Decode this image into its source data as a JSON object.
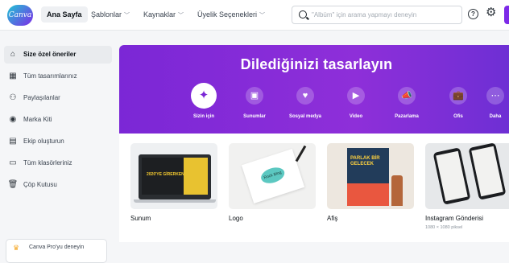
{
  "app": {
    "logo_text": "Canva"
  },
  "nav": {
    "home": "Ana Sayfa",
    "templates": "Şablonlar",
    "resources": "Kaynaklar",
    "membership": "Üyelik Seçenekleri"
  },
  "search": {
    "placeholder": "\"Albüm\" için arama yapmayı deneyin"
  },
  "header_icons": {
    "help": "?",
    "settings": "⚙"
  },
  "sidebar": {
    "items": [
      {
        "label": "Size özel öneriler",
        "icon": "home-icon",
        "glyph": "⌂"
      },
      {
        "label": "Tüm tasarımlarınız",
        "icon": "grid-icon",
        "glyph": "▦"
      },
      {
        "label": "Paylaşılanlar",
        "icon": "people-icon",
        "glyph": "⚇"
      },
      {
        "label": "Marka Kiti",
        "icon": "brand-icon",
        "glyph": "◉"
      },
      {
        "label": "Ekip oluşturun",
        "icon": "team-icon",
        "glyph": "▤"
      },
      {
        "label": "Tüm klasörleriniz",
        "icon": "folder-icon",
        "glyph": "▭"
      },
      {
        "label": "Çöp Kutusu",
        "icon": "trash-icon",
        "glyph": "🗑"
      }
    ],
    "pro": {
      "label": "Canva Pro'yu deneyin",
      "icon": "crown-icon",
      "glyph": "♛"
    }
  },
  "hero": {
    "title": "Dilediğinizi tasarlayın",
    "background": "#7b27d6",
    "categories": [
      {
        "label": "Sizin için",
        "icon": "sparkle-icon",
        "glyph": "✦",
        "selected": true
      },
      {
        "label": "Sunumlar",
        "icon": "presentation-icon",
        "glyph": "▣",
        "selected": false
      },
      {
        "label": "Sosyal medya",
        "icon": "heart-icon",
        "glyph": "♥",
        "selected": false
      },
      {
        "label": "Video",
        "icon": "video-icon",
        "glyph": "▶",
        "selected": false
      },
      {
        "label": "Pazarlama",
        "icon": "megaphone-icon",
        "glyph": "📣",
        "selected": false
      },
      {
        "label": "Ofis",
        "icon": "briefcase-icon",
        "glyph": "💼",
        "selected": false
      },
      {
        "label": "Daha",
        "icon": "more-icon",
        "glyph": "⋯",
        "selected": false
      }
    ]
  },
  "cards": [
    {
      "label": "Sunum",
      "thumb_text": "2020'YE GİRERKEN"
    },
    {
      "label": "Logo",
      "thumb_text": "Rock Blog"
    },
    {
      "label": "Afiş",
      "thumb_text": "PARLAK BİR GELECEK"
    },
    {
      "label": "Instagram Gönderisi",
      "sub": "1080 × 1080 piksel"
    }
  ],
  "colors": {
    "accent": "#7d2ae8",
    "hero": "#7b27d6",
    "sidebar_active": "#e9ebee"
  }
}
